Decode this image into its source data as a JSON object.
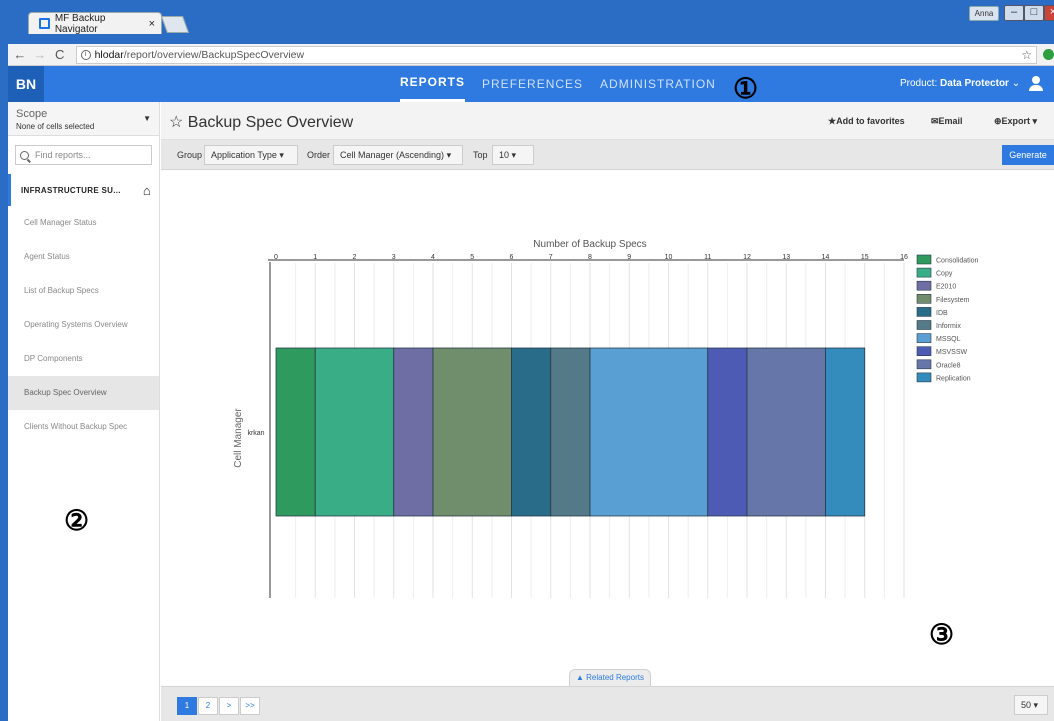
{
  "browser": {
    "tab_title": "MF Backup Navigator",
    "tab_close": "×",
    "user_chip": "Anna",
    "url_host": "hlodar",
    "url_path": "/report/overview/BackupSpecOverview",
    "min": "–",
    "max": "□",
    "close": "×"
  },
  "header": {
    "logo": "BN",
    "nav": [
      "REPORTS",
      "PREFERENCES",
      "ADMINISTRATION"
    ],
    "product_label": "Product:",
    "product_value": "Data Protector",
    "product_caret": "⌄"
  },
  "sidebar": {
    "scope_title": "Scope",
    "scope_sub": "None of cells selected",
    "find_placeholder": "Find reports...",
    "section": "INFRASTRUCTURE SU...",
    "items": [
      "Cell Manager Status",
      "Agent Status",
      "List of Backup Specs",
      "Operating Systems Overview",
      "DP Components",
      "Backup Spec Overview",
      "Clients Without Backup Spec"
    ],
    "active_index": 5
  },
  "title_bar": {
    "star": "☆",
    "title": "Backup Spec Overview",
    "favorites": "★Add to favorites",
    "email": "✉Email",
    "export": "⊕Export ▾"
  },
  "toolbar": {
    "group_label": "Group",
    "group_value": "Application Type",
    "order_label": "Order",
    "order_value": "Cell Manager (Ascending)",
    "top_label": "Top",
    "top_value": "10",
    "generate": "Generate"
  },
  "chart_data": {
    "type": "bar",
    "orientation": "horizontal-stacked",
    "title": "Number of Backup Specs",
    "ylabel": "Cell Manager",
    "categories": [
      "krkan"
    ],
    "xlim": [
      0,
      16
    ],
    "xticks": [
      "0",
      "1",
      "2",
      "3",
      "4",
      "5",
      "6",
      "7",
      "8",
      "9",
      "10",
      "11",
      "12",
      "13",
      "14",
      "15",
      "16"
    ],
    "grid": true,
    "legend_position": "right",
    "series": [
      {
        "name": "Consolidation",
        "values": [
          1
        ],
        "color": "#2e9a5e"
      },
      {
        "name": "Copy",
        "values": [
          2
        ],
        "color": "#38ad86"
      },
      {
        "name": "E2010",
        "values": [
          1
        ],
        "color": "#6e6ea4"
      },
      {
        "name": "Filesystem",
        "values": [
          2
        ],
        "color": "#708e6c"
      },
      {
        "name": "IDB",
        "values": [
          1
        ],
        "color": "#286c8a"
      },
      {
        "name": "Informix",
        "values": [
          1
        ],
        "color": "#537a86"
      },
      {
        "name": "MSSQL",
        "values": [
          3
        ],
        "color": "#5a9fd4"
      },
      {
        "name": "MSVSSW",
        "values": [
          1
        ],
        "color": "#4d5bb5"
      },
      {
        "name": "Oracle8",
        "values": [
          2
        ],
        "color": "#6776a8"
      },
      {
        "name": "Replication",
        "values": [
          1
        ],
        "color": "#338cbb"
      }
    ]
  },
  "related_reports": "▲ Related Reports",
  "badges": {
    "one": "①",
    "two": "②",
    "three": "③"
  },
  "footer": {
    "pages": [
      "1",
      "2",
      ">",
      ">>"
    ],
    "page_size": "50"
  }
}
